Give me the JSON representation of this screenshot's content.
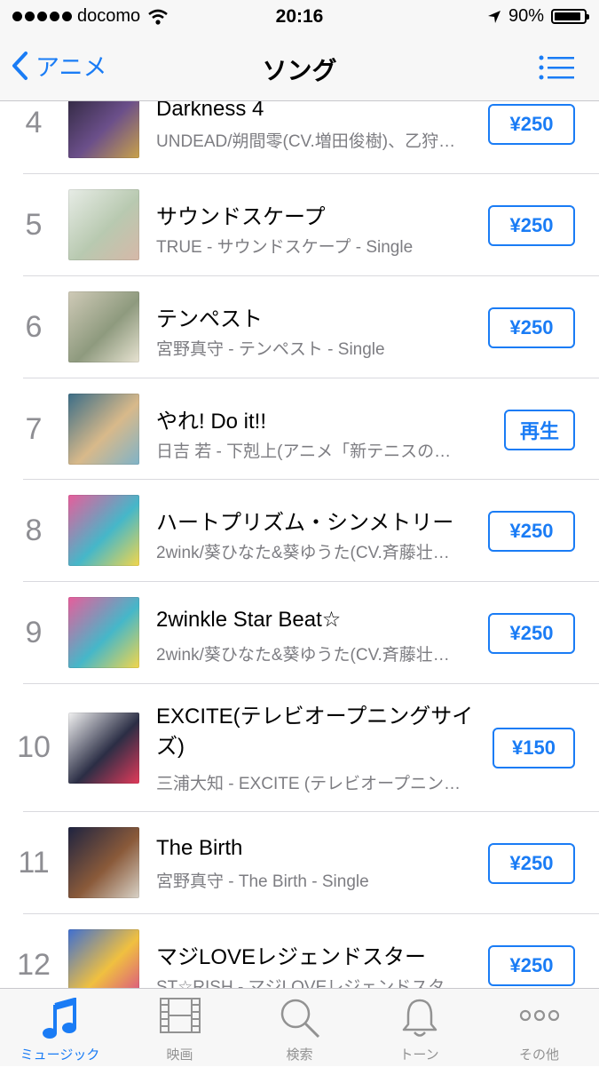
{
  "status_bar": {
    "carrier": "docomo",
    "time": "20:16",
    "battery": "90%",
    "battery_level": 0.9
  },
  "nav": {
    "back_label": "アニメ",
    "title": "ソング"
  },
  "songs": [
    {
      "rank": "4",
      "title": "Darkness 4",
      "subtitle": "UNDEAD/朔間零(CV.増田俊樹)、乙狩…",
      "button": "¥250",
      "art_colors": [
        "#2a2438",
        "#6b4f8a",
        "#c9a24a"
      ]
    },
    {
      "rank": "5",
      "title": "サウンドスケープ",
      "subtitle": "TRUE - サウンドスケープ - Single",
      "button": "¥250",
      "art_colors": [
        "#e7ece6",
        "#b8c9b0",
        "#d6b8a8"
      ]
    },
    {
      "rank": "6",
      "title": "テンペスト",
      "subtitle": "宮野真守 - テンペスト - Single",
      "button": "¥250",
      "art_colors": [
        "#cfcab7",
        "#8e9a7e",
        "#e8e3d2"
      ]
    },
    {
      "rank": "7",
      "title": "やれ! Do it!!",
      "subtitle": "日吉 若 - 下剋上(アニメ「新テニスの王子…",
      "button": "再生",
      "art_colors": [
        "#3b6d87",
        "#d8b98a",
        "#7fb3c8"
      ]
    },
    {
      "rank": "8",
      "title": "ハートプリズム・シンメトリー",
      "subtitle": "2wink/葵ひなた&葵ゆうた(CV.斉藤壮…",
      "button": "¥250",
      "art_colors": [
        "#e85d9b",
        "#45b7c9",
        "#f3d64b"
      ]
    },
    {
      "rank": "9",
      "title": "2winkle Star Beat☆",
      "subtitle": "2wink/葵ひなた&葵ゆうた(CV.斉藤壮…",
      "button": "¥250",
      "art_colors": [
        "#e85d9b",
        "#45b7c9",
        "#f3d64b"
      ]
    },
    {
      "rank": "10",
      "title": "EXCITE(テレビオープニングサイズ)",
      "subtitle": "三浦大知 - EXCITE (テレビオープニン…",
      "button": "¥150",
      "art_colors": [
        "#f2f2f2",
        "#2b2e45",
        "#e23a5a"
      ]
    },
    {
      "rank": "11",
      "title": "The Birth",
      "subtitle": "宮野真守 - The Birth - Single",
      "button": "¥250",
      "art_colors": [
        "#1e2340",
        "#8a5a3a",
        "#d9d3c8"
      ]
    },
    {
      "rank": "12",
      "title": "マジLOVEレジェンドスター",
      "subtitle": "ST☆RISH - マジLOVEレジェンドスタ…",
      "button": "¥250",
      "art_colors": [
        "#3f6fd1",
        "#f0c040",
        "#d84a8a"
      ]
    }
  ],
  "tabs": [
    {
      "label": "ミュージック",
      "icon": "music-note-icon",
      "active": true
    },
    {
      "label": "映画",
      "icon": "film-icon",
      "active": false
    },
    {
      "label": "検索",
      "icon": "search-icon",
      "active": false
    },
    {
      "label": "トーン",
      "icon": "bell-icon",
      "active": false
    },
    {
      "label": "その他",
      "icon": "more-icon",
      "active": false
    }
  ],
  "colors": {
    "accent": "#1a7cf5",
    "secondary_text": "#7d7d82",
    "rank": "#8e8e93"
  }
}
